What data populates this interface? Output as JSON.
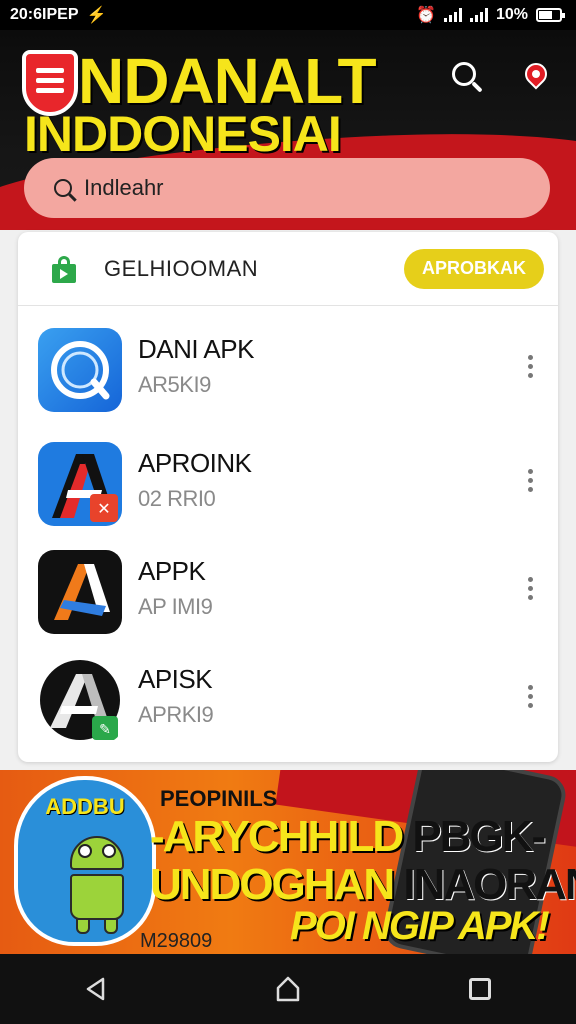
{
  "status_bar": {
    "left_text": "20:6IPEP",
    "left_icon": "usb-icon",
    "battery_text": "10%",
    "battery_level": 0.6
  },
  "header": {
    "title_line1": "NDANALT",
    "title_line2": "INDDONESIAI",
    "search_label": "search",
    "pin_label": "location"
  },
  "search": {
    "value": "Indleahr"
  },
  "card": {
    "title": "GELHIOOMAN",
    "action_label": "APROBKAK"
  },
  "apps": [
    {
      "name": "DANI APK",
      "sub": "AR5KI9"
    },
    {
      "name": "APROINK",
      "sub": "02 RRI0"
    },
    {
      "name": "APPK",
      "sub": "AP IMI9"
    },
    {
      "name": "APISK",
      "sub": "APRKI9"
    }
  ],
  "banner": {
    "badge": "ADDBU",
    "line1": "PEOPINILS",
    "line2_a": "-ARYCHHILD",
    "line2_b": "PBGK-",
    "line3_a": "UNDOGHAN",
    "line3_b": "INAORAN",
    "line4": "POI NGIP APK!",
    "footer": "M29809"
  },
  "colors": {
    "brand_yellow": "#f6e51b",
    "brand_red": "#c4161c",
    "pill_yellow": "#e6cf1a"
  }
}
